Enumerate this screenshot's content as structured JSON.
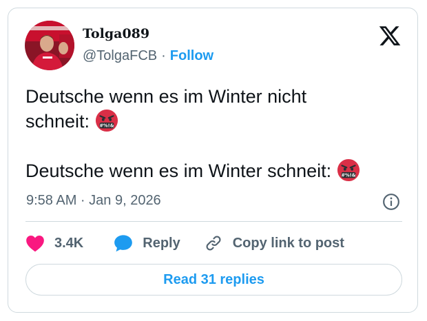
{
  "author": {
    "display_name": "Tolga089",
    "handle": "@TolgaFCB",
    "separator": "·",
    "follow_label": "Follow",
    "avatar": "profile-photo-red-jersey"
  },
  "brand": {
    "icon": "x-logo-icon"
  },
  "tweet": {
    "lines": [
      "Deutsche wenn es im Winter nicht",
      "schneit:",
      "Deutsche wenn es im Winter schneit:"
    ],
    "emoji": "face-with-symbols-on-mouth-emoji",
    "emoji_symbols": "#%!&",
    "timestamp": "9:58 AM · Jan 9, 2026"
  },
  "actions": {
    "like_icon": "heart-icon",
    "like_count": "3.4K",
    "reply_icon": "speech-bubble-icon",
    "reply_label": "Reply",
    "copy_icon": "link-icon",
    "copy_label": "Copy link to post"
  },
  "footer": {
    "read_replies_label": "Read 31 replies"
  },
  "colors": {
    "accent": "#1d9bf0",
    "like": "#f91880",
    "text": "#0f1419",
    "muted": "#536471",
    "border": "#cfd9de"
  }
}
